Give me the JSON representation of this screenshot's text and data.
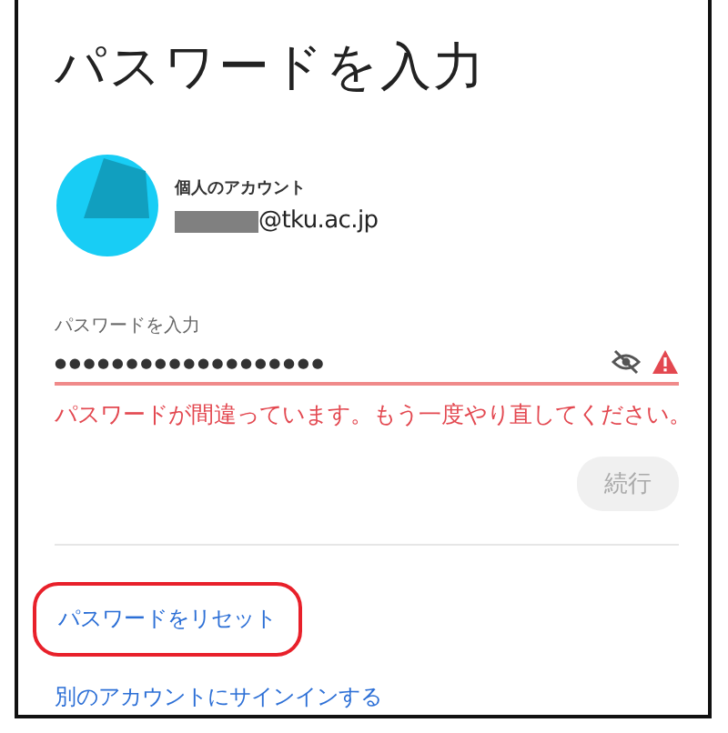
{
  "title": "パスワードを入力",
  "account": {
    "type_label": "個人のアカウント",
    "email": "@tku.ac.jp",
    "email_redacted": true
  },
  "password_field": {
    "label": "パスワードを入力",
    "value": "●●●●●●●●●●●●●●●●●●●",
    "error": true,
    "error_message": "パスワードが間違っています。もう一度やり直してください。"
  },
  "continue_button": {
    "label": "続行",
    "disabled": true
  },
  "links": [
    {
      "label": "パスワードをリセット",
      "highlighted": true
    },
    {
      "label": "別のアカウントにサインインする",
      "highlighted": false
    }
  ]
}
